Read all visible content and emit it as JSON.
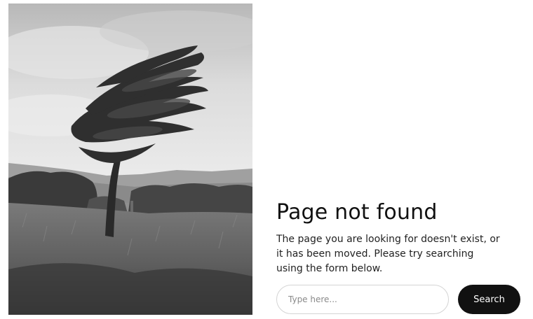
{
  "not_found": {
    "title": "Page not found",
    "message": "The page you are looking for doesn't exist, or it has been moved. Please try searching using the form below."
  },
  "search": {
    "placeholder": "Type here...",
    "value": "",
    "button_label": "Search"
  },
  "photo": {
    "subject": "windswept tree",
    "style": "black-and-white"
  },
  "colors": {
    "background": "#ffffff",
    "text": "#111111",
    "button": "#111111",
    "button_text": "#ffffff",
    "input_border": "#d4d4d4"
  }
}
